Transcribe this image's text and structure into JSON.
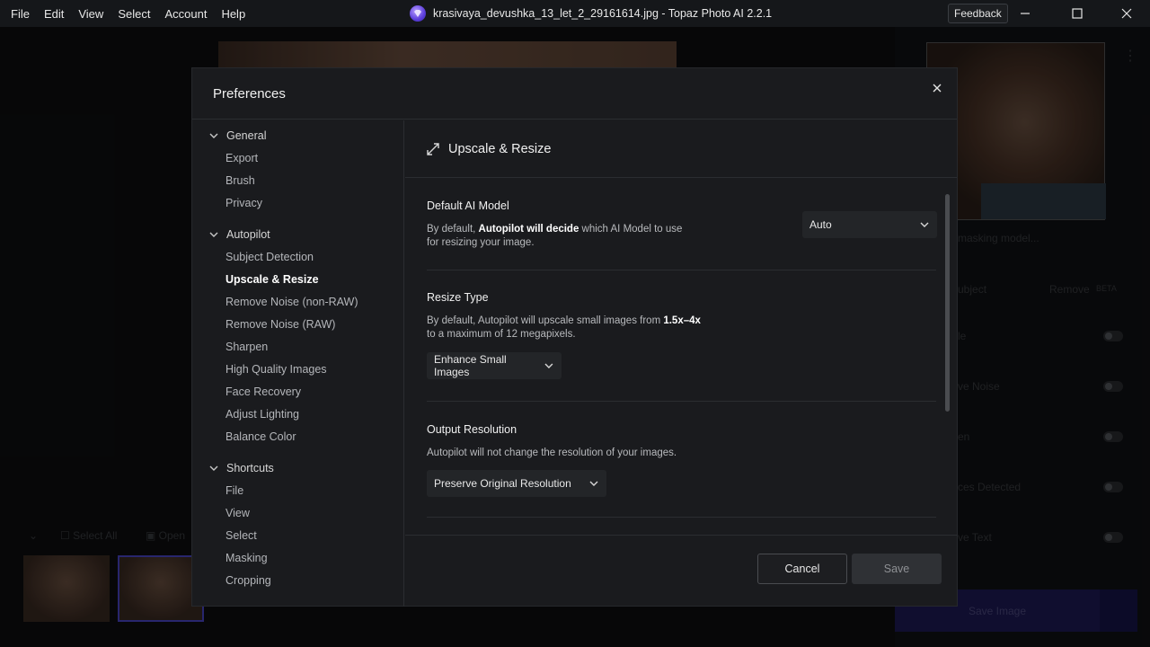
{
  "menubar": [
    "File",
    "Edit",
    "View",
    "Select",
    "Account",
    "Help"
  ],
  "window_title": "krasivaya_devushka_13_let_2_29161614.jpg - Topaz Photo AI 2.2.1",
  "feedback_label": "Feedback",
  "background": {
    "select_all": "Select All",
    "open_label": "Open",
    "masking_hint": "masking model...",
    "subject_label": "ubject",
    "remove_label": "Remove",
    "beta_label": "BETA",
    "rows": [
      "le",
      "ve Noise",
      "en",
      "ces Detected",
      "ve Text"
    ],
    "save_image": "Save Image"
  },
  "dialog": {
    "title": "Preferences",
    "sidebar": {
      "groups": [
        {
          "label": "General",
          "items": [
            "Export",
            "Brush",
            "Privacy"
          ]
        },
        {
          "label": "Autopilot",
          "items": [
            "Subject Detection",
            "Upscale & Resize",
            "Remove Noise (non-RAW)",
            "Remove Noise (RAW)",
            "Sharpen",
            "High Quality Images",
            "Face Recovery",
            "Adjust Lighting",
            "Balance Color"
          ]
        },
        {
          "label": "Shortcuts",
          "items": [
            "File",
            "View",
            "Select",
            "Masking",
            "Cropping"
          ]
        }
      ],
      "active_item": "Upscale & Resize"
    },
    "content": {
      "title": "Upscale & Resize",
      "sections": {
        "default_model": {
          "title": "Default AI Model",
          "desc_pre": "By default, ",
          "desc_bold": "Autopilot will decide",
          "desc_post": " which AI Model to use for resizing your image.",
          "select_value": "Auto"
        },
        "resize_type": {
          "title": "Resize Type",
          "desc_pre": "By default, Autopilot will upscale small images from ",
          "desc_bold": "1.5x–4x",
          "desc_post": " to a maximum of 12 megapixels.",
          "select_value": "Enhance Small Images"
        },
        "output_resolution": {
          "title": "Output Resolution",
          "desc": "Autopilot will not change the resolution of your images.",
          "select_value": "Preserve Original Resolution"
        }
      }
    },
    "footer": {
      "cancel": "Cancel",
      "save": "Save"
    }
  }
}
